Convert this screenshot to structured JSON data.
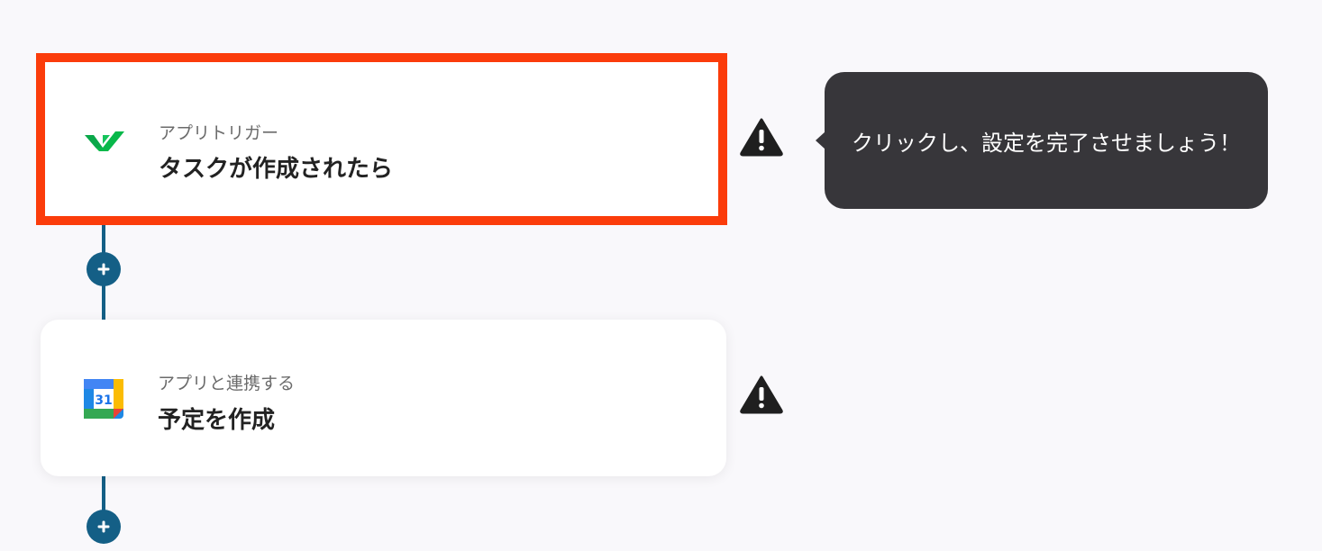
{
  "flow": {
    "steps": [
      {
        "subtitle": "アプリトリガー",
        "title": "タスクが作成されたら",
        "icon": "wrike-icon",
        "highlighted": true,
        "status_icon": "warning-icon"
      },
      {
        "subtitle": "アプリと連携する",
        "title": "予定を作成",
        "icon": "google-calendar-icon",
        "icon_text": "31",
        "highlighted": false,
        "status_icon": "warning-icon"
      }
    ],
    "add_step_icon": "plus-icon"
  },
  "tooltip": {
    "text": "クリックし、設定を完了させましょう！"
  },
  "colors": {
    "background": "#f9f8fb",
    "connector": "#145f86",
    "highlight_border": "#fb3c0b",
    "tooltip_bg": "#37363a",
    "wrike_green": "#08b84a"
  }
}
